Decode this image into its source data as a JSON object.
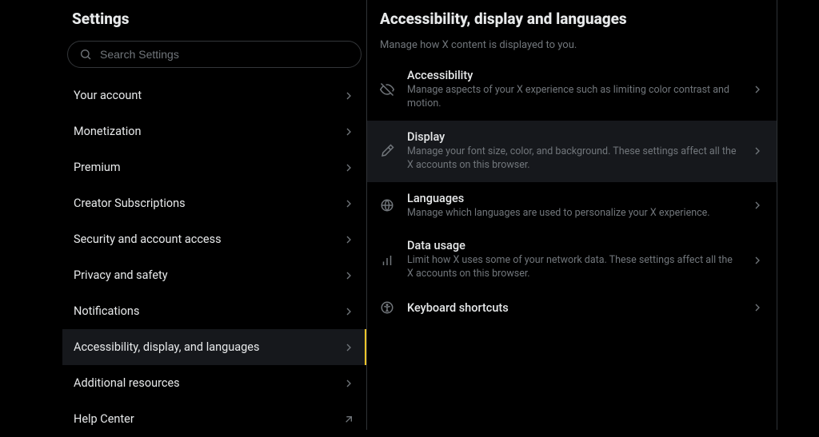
{
  "sidebar": {
    "title": "Settings",
    "search_placeholder": "Search Settings",
    "items": [
      {
        "label": "Your account"
      },
      {
        "label": "Monetization"
      },
      {
        "label": "Premium"
      },
      {
        "label": "Creator Subscriptions"
      },
      {
        "label": "Security and account access"
      },
      {
        "label": "Privacy and safety"
      },
      {
        "label": "Notifications"
      },
      {
        "label": "Accessibility, display, and languages"
      },
      {
        "label": "Additional resources"
      },
      {
        "label": "Help Center"
      }
    ]
  },
  "main": {
    "title": "Accessibility, display and languages",
    "subtitle": "Manage how X content is displayed to you.",
    "options": [
      {
        "title": "Accessibility",
        "desc": "Manage aspects of your X experience such as limiting color contrast and motion."
      },
      {
        "title": "Display",
        "desc": "Manage your font size, color, and background. These settings affect all the X accounts on this browser."
      },
      {
        "title": "Languages",
        "desc": "Manage which languages are used to personalize your X experience."
      },
      {
        "title": "Data usage",
        "desc": "Limit how X uses some of your network data. These settings affect all the X accounts on this browser."
      },
      {
        "title": "Keyboard shortcuts",
        "desc": ""
      }
    ]
  }
}
